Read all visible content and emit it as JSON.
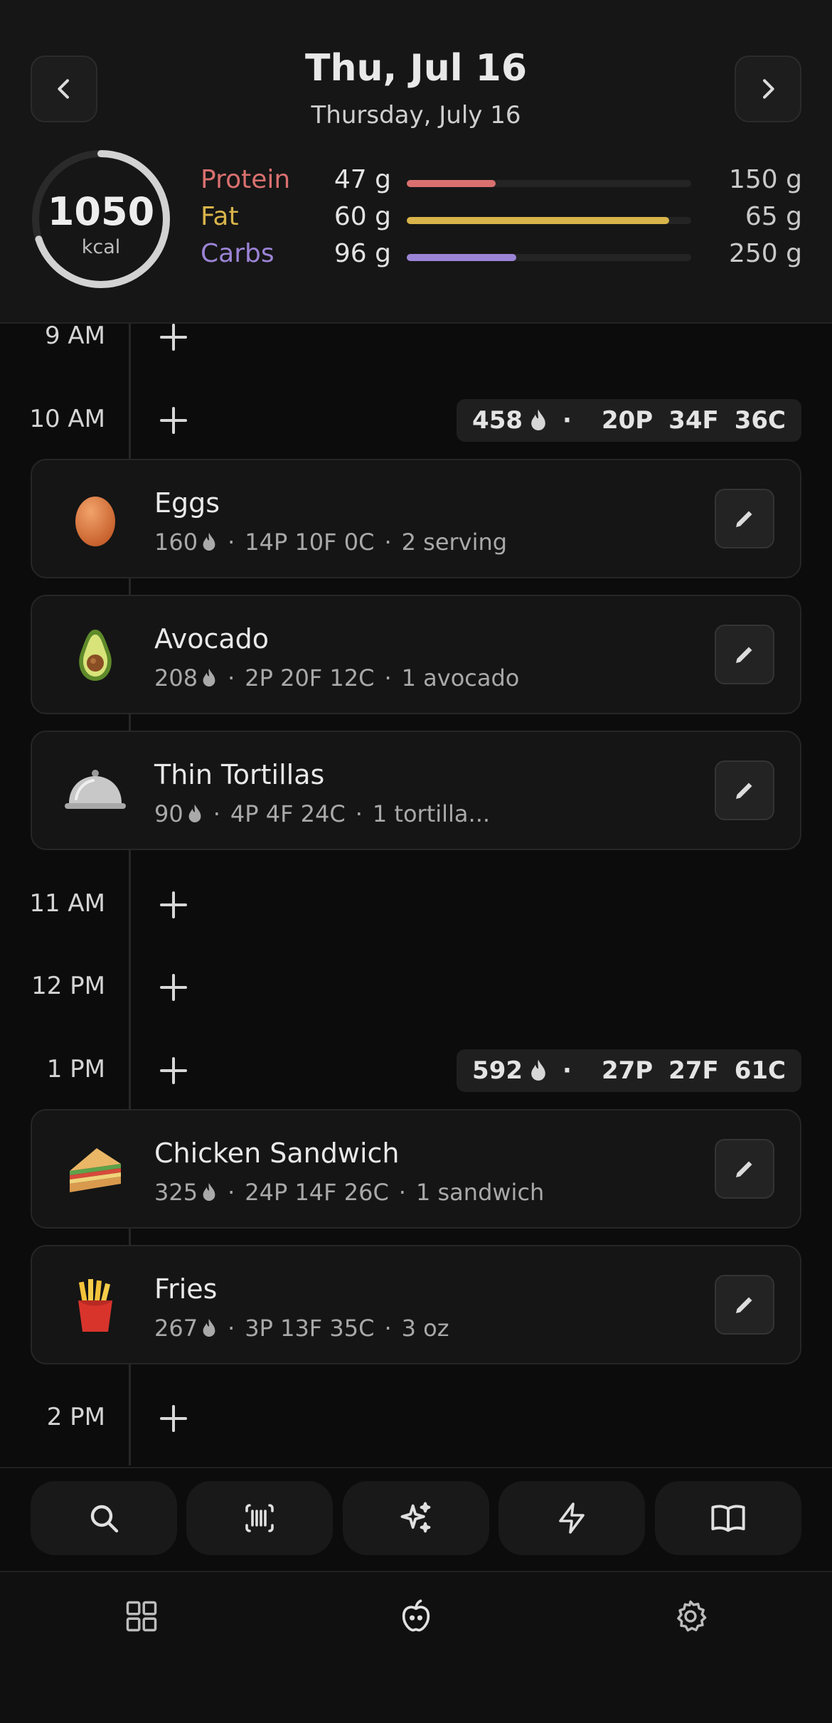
{
  "header": {
    "title": "Thu, Jul 16",
    "subtitle": "Thursday, July 16",
    "calories": {
      "value": "1050",
      "unit": "kcal",
      "progress": 0.7
    },
    "macros": [
      {
        "name": "Protein",
        "value": "47 g",
        "goal": "150 g",
        "color": "#d9706f",
        "fill": 0.313
      },
      {
        "name": "Fat",
        "value": "60 g",
        "goal": "65 g",
        "color": "#d8b44a",
        "fill": 0.923
      },
      {
        "name": "Carbs",
        "value": "96 g",
        "goal": "250 g",
        "color": "#9b84d6",
        "fill": 0.384
      }
    ]
  },
  "timeline": {
    "hours": [
      "9 AM",
      "10 AM",
      "11 AM",
      "12 PM",
      "1 PM",
      "2 PM"
    ],
    "summaries": [
      {
        "hour": "10 AM",
        "kcal": "458",
        "p": "20P",
        "f": "34F",
        "c": "36C"
      },
      {
        "hour": "1 PM",
        "kcal": "592",
        "p": "27P",
        "f": "27F",
        "c": "61C"
      }
    ],
    "entries": [
      {
        "name": "Eggs",
        "kcal": "160",
        "macros": "14P 10F 0C",
        "serving": "2 serving",
        "icon": "egg-icon"
      },
      {
        "name": "Avocado",
        "kcal": "208",
        "macros": "2P 20F 12C",
        "serving": "1 avocado",
        "icon": "avocado-icon"
      },
      {
        "name": "Thin Tortillas",
        "kcal": "90",
        "macros": "4P 4F 24C",
        "serving": "1 tortilla...",
        "icon": "cloche-icon"
      },
      {
        "name": "Chicken Sandwich",
        "kcal": "325",
        "macros": "24P 14F 26C",
        "serving": "1 sandwich",
        "icon": "sandwich-icon"
      },
      {
        "name": "Fries",
        "kcal": "267",
        "macros": "3P 13F 35C",
        "serving": "3 oz",
        "icon": "fries-icon"
      }
    ]
  },
  "actions": [
    "search-icon",
    "barcode-icon",
    "sparkles-icon",
    "lightning-icon",
    "book-icon"
  ],
  "bottom_nav": [
    "grid-icon",
    "apple-icon",
    "gear-icon"
  ]
}
